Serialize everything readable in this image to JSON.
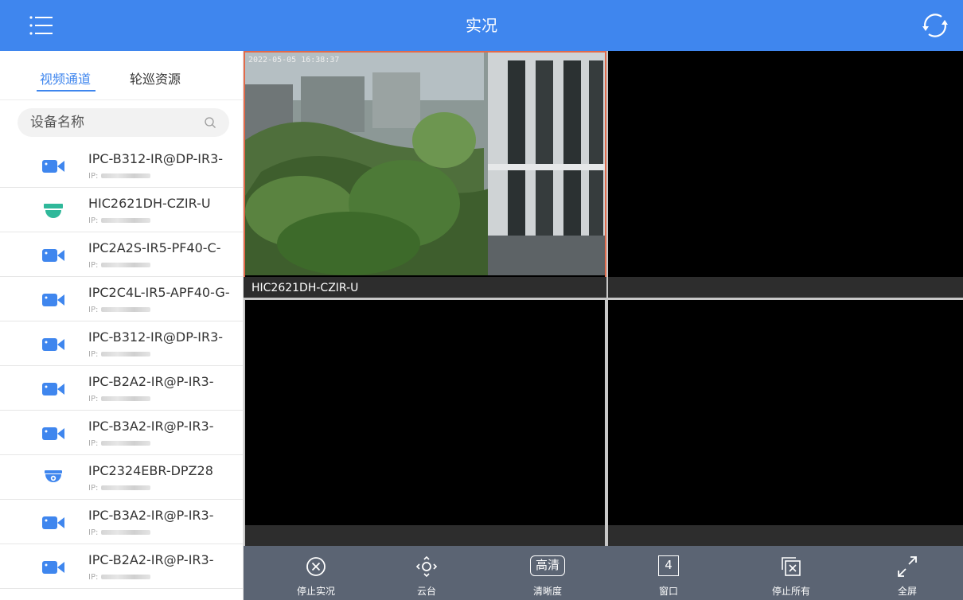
{
  "header": {
    "title": "实况",
    "menu_icon": "menu-icon",
    "refresh_icon": "refresh-icon",
    "bg_color": "#3f86ee"
  },
  "sidebar": {
    "tabs": [
      {
        "label": "视频通道",
        "active": true
      },
      {
        "label": "轮巡资源",
        "active": false
      }
    ],
    "search": {
      "placeholder": "设备名称",
      "icon": "search-icon"
    },
    "devices": [
      {
        "name": "IPC-B312-IR@DP-IR3-",
        "ip_label": "IP:",
        "icon": "bullet-camera-icon"
      },
      {
        "name": "HIC2621DH-CZIR-U",
        "ip_label": "IP:",
        "icon": "dome-camera-icon"
      },
      {
        "name": "IPC2A2S-IR5-PF40-C-",
        "ip_label": "IP:",
        "icon": "bullet-camera-icon"
      },
      {
        "name": "IPC2C4L-IR5-APF40-G-",
        "ip_label": "IP:",
        "icon": "bullet-camera-icon"
      },
      {
        "name": "IPC-B312-IR@DP-IR3-",
        "ip_label": "IP:",
        "icon": "bullet-camera-icon"
      },
      {
        "name": "IPC-B2A2-IR@P-IR3-",
        "ip_label": "IP:",
        "icon": "bullet-camera-icon"
      },
      {
        "name": "IPC-B3A2-IR@P-IR3-",
        "ip_label": "IP:",
        "icon": "bullet-camera-icon"
      },
      {
        "name": "IPC2324EBR-DPZ28",
        "ip_label": "IP:",
        "icon": "turret-camera-icon"
      },
      {
        "name": "IPC-B3A2-IR@P-IR3-",
        "ip_label": "IP:",
        "icon": "bullet-camera-icon"
      },
      {
        "name": "IPC-B2A2-IR@P-IR3-",
        "ip_label": "IP:",
        "icon": "bullet-camera-icon"
      }
    ]
  },
  "video": {
    "cells": [
      {
        "label": "HIC2621DH-CZIR-U",
        "timestamp": "2022-05-05 16:38:37",
        "selected": true
      },
      {
        "label": "",
        "selected": false
      },
      {
        "label": "",
        "selected": false
      },
      {
        "label": "",
        "selected": false
      }
    ]
  },
  "toolbar": {
    "items": [
      {
        "label": "停止实况",
        "icon": "stop-live-icon"
      },
      {
        "label": "云台",
        "icon": "ptz-icon"
      },
      {
        "label": "清晰度",
        "icon": "hd-icon",
        "icon_text": "高清"
      },
      {
        "label": "窗口",
        "icon": "window-icon",
        "icon_text": "4"
      },
      {
        "label": "停止所有",
        "icon": "stop-all-icon"
      },
      {
        "label": "全屏",
        "icon": "fullscreen-icon"
      }
    ]
  },
  "colors": {
    "accent": "#3f86ee",
    "toolbar_bg": "#5b6473",
    "selected_border": "#e26a4a"
  }
}
